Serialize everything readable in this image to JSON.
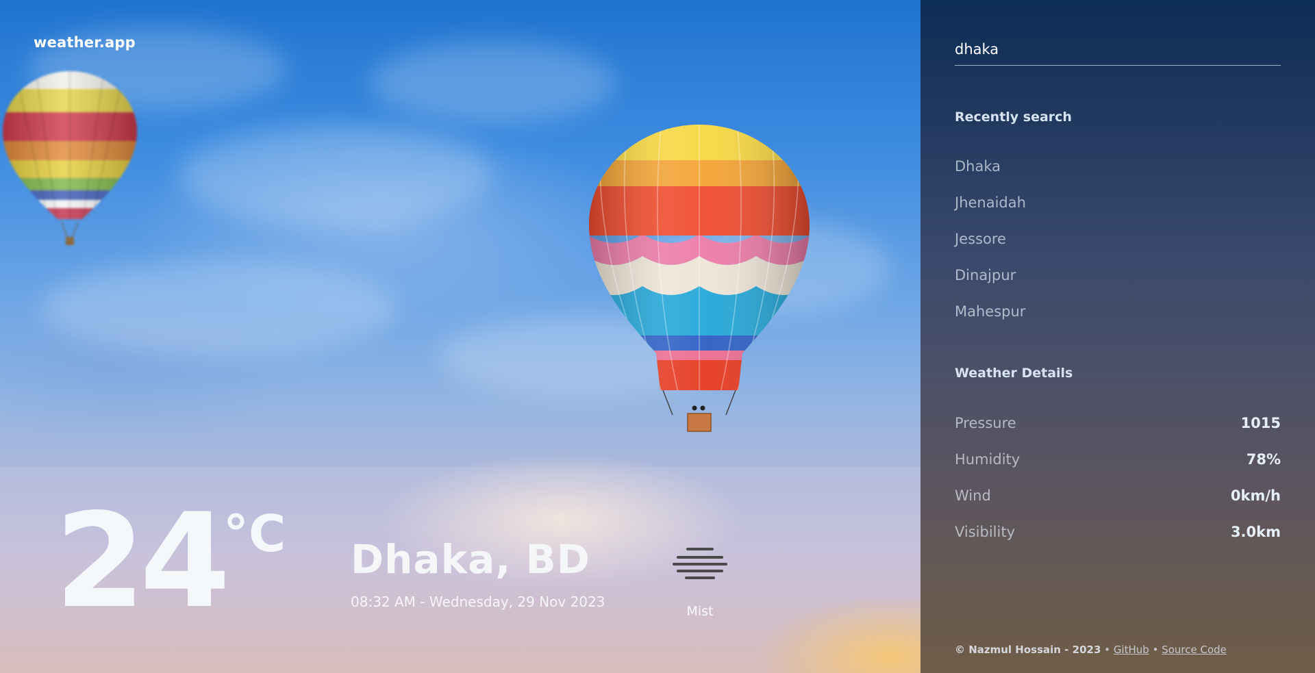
{
  "app": {
    "logo": "weather.app"
  },
  "current": {
    "temperature": "24",
    "unit": "°C",
    "location": "Dhaka, BD",
    "datetime": "08:32 AM - Wednesday, 29 Nov 2023",
    "condition": "Mist",
    "condition_icon": "mist-icon"
  },
  "sidebar": {
    "search_value": "dhaka",
    "recent_title": "Recently search",
    "recent": [
      "Dhaka",
      "Jhenaidah",
      "Jessore",
      "Dinajpur",
      "Mahespur"
    ],
    "details_title": "Weather Details",
    "details": [
      {
        "label": "Pressure",
        "value": "1015"
      },
      {
        "label": "Humidity",
        "value": "78%"
      },
      {
        "label": "Wind",
        "value": "0km/h"
      },
      {
        "label": "Visibility",
        "value": "3.0km"
      }
    ]
  },
  "footer": {
    "copyright": "© Nazmul Hossain - 2023",
    "sep1": "•",
    "github": "GitHub",
    "sep2": "•",
    "source": "Source Code"
  }
}
